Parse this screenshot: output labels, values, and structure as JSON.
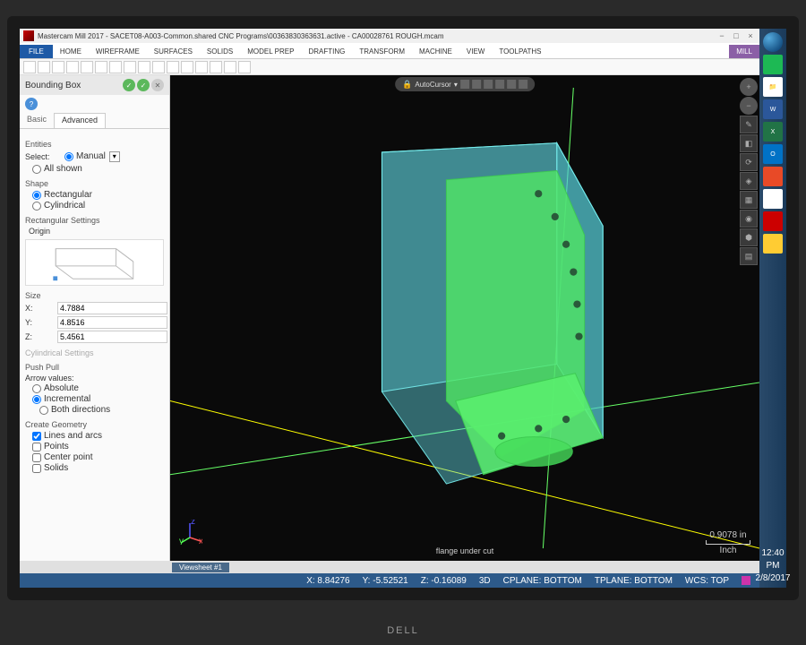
{
  "title": "Mastercam Mill 2017 - SACET08-A003-Common.shared CNC Programs\\00363830363631.active - CA00028761 ROUGH.mcam",
  "ribbon": {
    "file": "FILE",
    "tabs": [
      "HOME",
      "WIREFRAME",
      "SURFACES",
      "SOLIDS",
      "MODEL PREP",
      "DRAFTING",
      "TRANSFORM",
      "MACHINE",
      "VIEW",
      "TOOLPATHS"
    ],
    "context": "MILL"
  },
  "panel": {
    "title": "Bounding Box",
    "tabs": {
      "basic": "Basic",
      "advanced": "Advanced"
    },
    "entities": {
      "label": "Entities",
      "select_label": "Select:",
      "select_mode": "Manual",
      "all_shown": "All shown"
    },
    "shape": {
      "label": "Shape",
      "rectangular": "Rectangular",
      "cylindrical": "Cylindrical"
    },
    "rect_settings": {
      "label": "Rectangular Settings",
      "origin": "Origin"
    },
    "size": {
      "label": "Size",
      "x": "4.7884",
      "y": "4.8516",
      "z": "5.4561"
    },
    "cyl_settings": {
      "label": "Cylindrical Settings"
    },
    "push_pull": {
      "label": "Push Pull",
      "arrow_label": "Arrow values:",
      "absolute": "Absolute",
      "incremental": "Incremental",
      "both": "Both directions"
    },
    "geom": {
      "label": "Create Geometry",
      "lines": "Lines and arcs",
      "points": "Points",
      "center": "Center point",
      "solids": "Solids"
    }
  },
  "viewport": {
    "toolbar_text": "AutoCursor",
    "view_label": "flange under cut",
    "scale_value": "0.9078 in",
    "scale_unit": "Inch",
    "sheet_tab": "Viewsheet #1"
  },
  "status": {
    "x": "X: 8.84276",
    "y": "Y: -5.52521",
    "z": "Z: -0.16089",
    "view": "3D",
    "cplane": "CPLANE: BOTTOM",
    "tplane": "TPLANE: BOTTOM",
    "wcs": "WCS: TOP"
  },
  "os": {
    "time": "12:40 PM",
    "date": "2/8/2017"
  },
  "monitor_brand": "DELL"
}
